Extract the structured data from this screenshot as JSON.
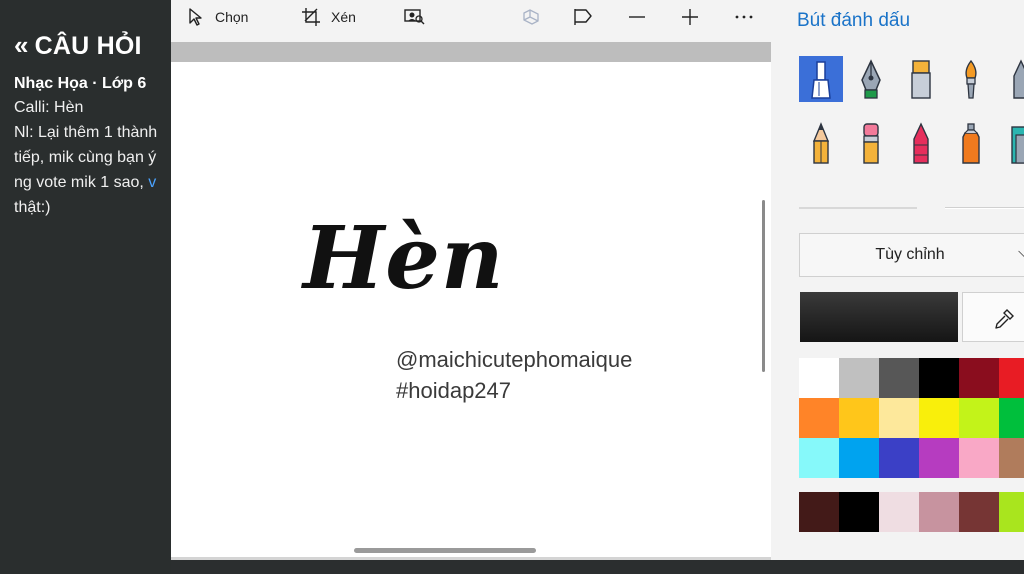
{
  "background_page": {
    "title": "CÂU HỎI",
    "subject": "Nhạc Họa · Lớp 6",
    "lines": [
      "Calli: Hèn",
      "Nl: Lại thêm 1 thành",
      "tiếp, mik cùng bạn ý",
      "ng vote mik 1 sao, ",
      "thật:)"
    ],
    "link_fragment": "v"
  },
  "toolbar": {
    "select_label": "Chọn",
    "crop_label": "Xén"
  },
  "canvas": {
    "art_text": "Hèn",
    "handle": "@maichicutephomaique",
    "hashtag": "#hoidap247"
  },
  "panel": {
    "title": "Bút đánh dấu",
    "dropdown_label": "Tùy chỉnh",
    "current_color": "#222222",
    "accent_color": "#3b6fd8",
    "title_color": "#1a73c8",
    "tools": [
      "marker-icon",
      "calligraphy-pen-icon",
      "highlighter-icon",
      "oil-brush-icon",
      "crayon-icon",
      "pencil-icon",
      "eraser-pencil-icon",
      "crayon-red-icon",
      "spray-can-icon",
      "paint-bucket-icon"
    ],
    "palette": [
      [
        "#ffffff",
        "#c0c0c0",
        "#575757",
        "#000000",
        "#8a0d1e",
        "#e81c24"
      ],
      [
        "#ff8428",
        "#ffc61a",
        "#fde89b",
        "#f9ef0b",
        "#c3f319",
        "#00bf3c"
      ],
      [
        "#86f9fa",
        "#00a3ef",
        "#3b40c6",
        "#b63cc0",
        "#f9a8c6",
        "#b07c5c"
      ]
    ],
    "recent_colors": [
      "#431a18",
      "#000000",
      "#efdde2",
      "#c7939f",
      "#763534",
      "#a9e51e"
    ]
  }
}
